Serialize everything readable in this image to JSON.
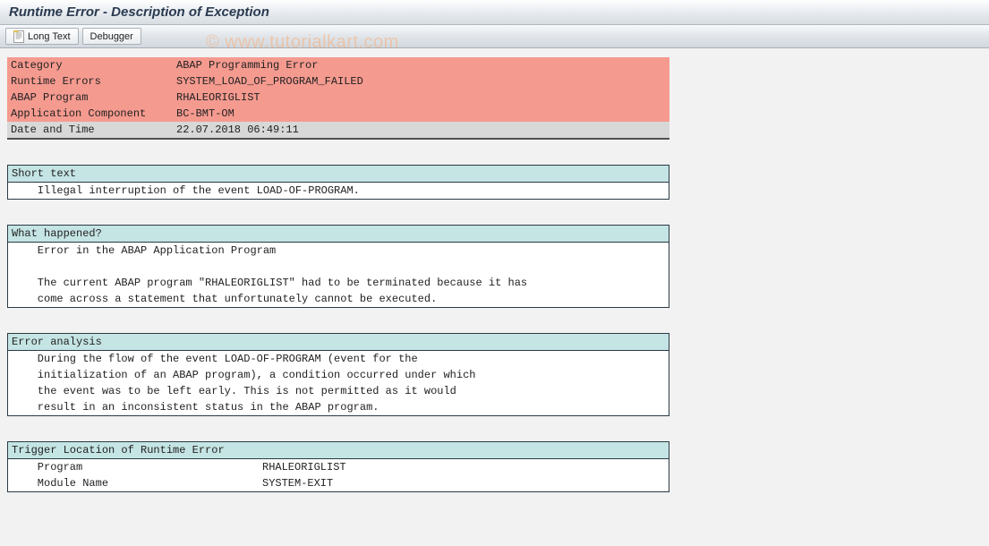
{
  "title": "Runtime Error - Description of Exception",
  "toolbar": {
    "longtext": "Long Text",
    "debugger": "Debugger"
  },
  "header": {
    "rows": [
      {
        "label": "Category",
        "value": "ABAP Programming Error",
        "style": "red"
      },
      {
        "label": "Runtime Errors",
        "value": "SYSTEM_LOAD_OF_PROGRAM_FAILED",
        "style": "red"
      },
      {
        "label": "ABAP Program",
        "value": "RHALEORIGLIST",
        "style": "red"
      },
      {
        "label": "Application Component",
        "value": "BC-BMT-OM",
        "style": "red"
      },
      {
        "label": "Date and Time",
        "value": "22.07.2018 06:49:11",
        "style": "gray"
      }
    ]
  },
  "sections": {
    "short_text": {
      "title": "Short text",
      "lines": [
        "    Illegal interruption of the event LOAD-OF-PROGRAM."
      ]
    },
    "what_happened": {
      "title": "What happened?",
      "lines": [
        "    Error in the ABAP Application Program",
        "",
        "    The current ABAP program \"RHALEORIGLIST\" had to be terminated because it has",
        "    come across a statement that unfortunately cannot be executed."
      ]
    },
    "error_analysis": {
      "title": "Error analysis",
      "lines": [
        "    During the flow of the event LOAD-OF-PROGRAM (event for the",
        "    initialization of an ABAP program), a condition occurred under which",
        "    the event was to be left early. This is not permitted as it would",
        "    result in an inconsistent status in the ABAP program."
      ]
    },
    "trigger": {
      "title": "Trigger Location of Runtime Error",
      "rows": [
        {
          "label": "    Program",
          "value": "RHALEORIGLIST"
        },
        {
          "label": "    Module Name",
          "value": "SYSTEM-EXIT"
        }
      ]
    }
  },
  "watermark": "© www.tutorialkart.com"
}
